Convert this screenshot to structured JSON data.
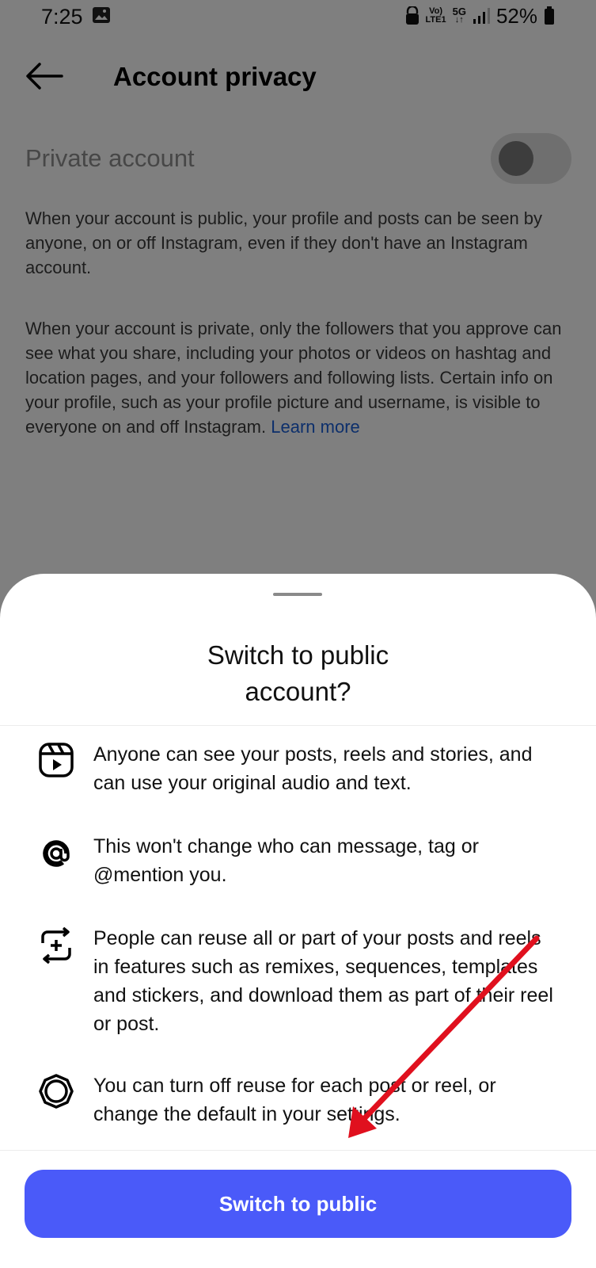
{
  "status_bar": {
    "time": "7:25",
    "battery": "52%",
    "network_volte": "Vo)",
    "network_lte": "LTE1",
    "network_5g": "5G"
  },
  "header": {
    "title": "Account privacy"
  },
  "settings": {
    "private_account_label": "Private account",
    "private_account_enabled": false,
    "public_description": "When your account is public, your profile and posts can be seen by anyone, on or off Instagram, even if they don't have an Instagram account.",
    "private_description": "When your account is private, only the followers that you approve can see what you share, including your photos or videos on hashtag and location pages, and your followers and following lists. Certain info on your profile, such as your profile picture and username, is visible to everyone on and off Instagram.",
    "learn_more": "Learn more"
  },
  "sheet": {
    "title_line1": "Switch to public",
    "title_line2": "account?",
    "items": [
      {
        "icon": "reels-icon",
        "text": "Anyone can see your posts, reels and stories, and can use your original audio and text."
      },
      {
        "icon": "at-mention-icon",
        "text": "This won't change who can message, tag or @mention you."
      },
      {
        "icon": "remix-icon",
        "text": "People can reuse all or part of your posts and reels in features such as remixes, sequences, templates and stickers, and download them as part of their reel or post."
      },
      {
        "icon": "settings-gear-icon",
        "text": "You can turn off reuse for each post or reel, or change the default in your settings."
      }
    ],
    "button_label": "Switch to public"
  },
  "colors": {
    "accent_button": "#4a5af9",
    "link": "#1a5fd6",
    "annotation_arrow": "#e0101e"
  }
}
